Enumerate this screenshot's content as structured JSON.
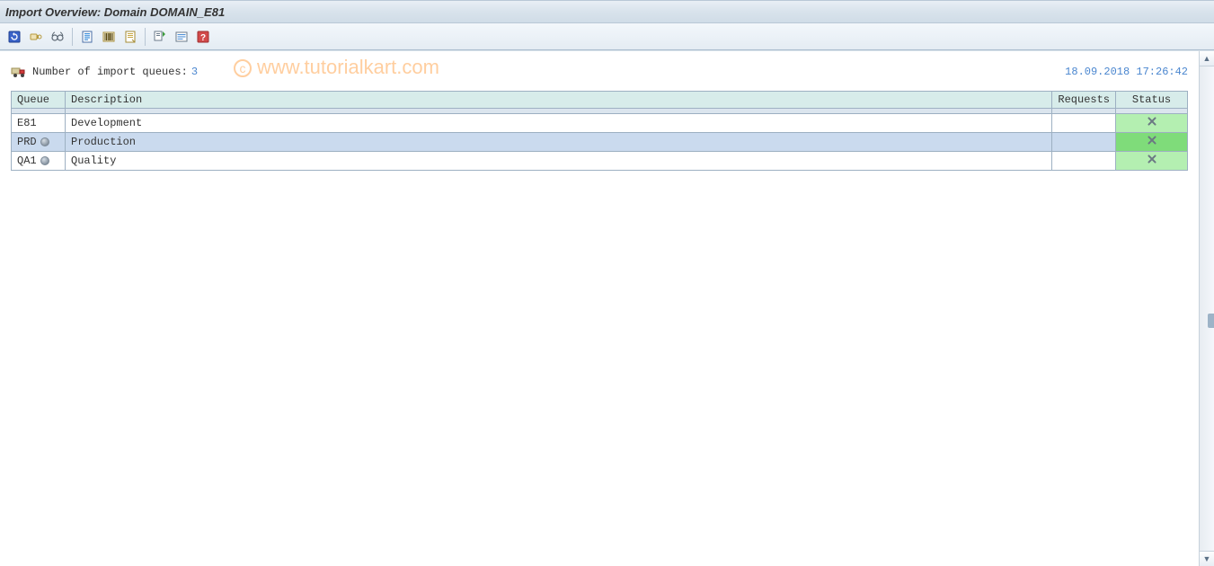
{
  "title": "Import Overview: Domain DOMAIN_E81",
  "toolbar_icons": [
    "refresh-icon",
    "display-icon",
    "glasses-icon",
    "sep",
    "page-icon",
    "barcode-icon",
    "properties-icon",
    "sep",
    "log-icon",
    "list-icon",
    "help-icon"
  ],
  "info": {
    "label": "Number of import queues:",
    "count": "3",
    "timestamp": "18.09.2018 17:26:42"
  },
  "table": {
    "headers": {
      "queue": "Queue",
      "desc": "Description",
      "req": "Requests",
      "status": "Status"
    },
    "rows": [
      {
        "queue": "E81",
        "desc": "Development",
        "req": "",
        "has_icon": false,
        "selected": false
      },
      {
        "queue": "PRD",
        "desc": "Production",
        "req": "",
        "has_icon": true,
        "selected": true
      },
      {
        "queue": "QA1",
        "desc": "Quality",
        "req": "",
        "has_icon": true,
        "selected": false
      }
    ]
  },
  "watermark": "www.tutorialkart.com"
}
